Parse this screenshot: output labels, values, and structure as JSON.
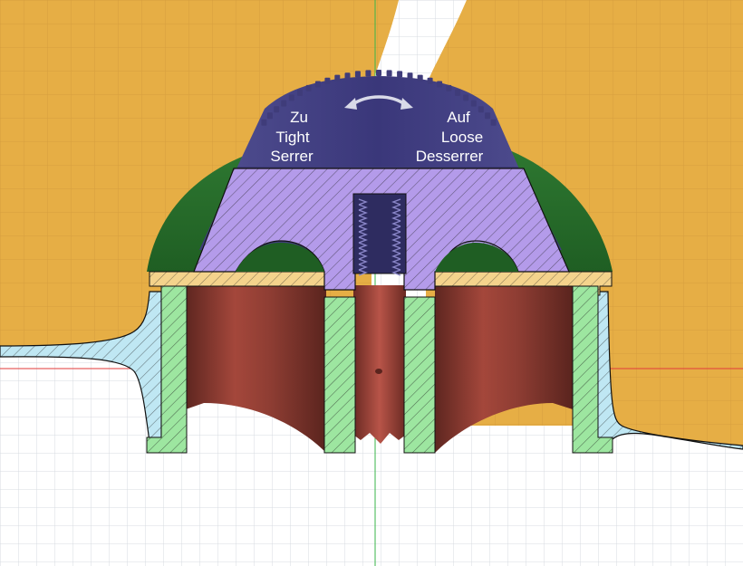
{
  "viewport": {
    "title": "",
    "cap_labels": {
      "left": [
        "Zu",
        "Tight",
        "Serrer"
      ],
      "right": [
        "Auf",
        "Loose",
        "Desserrer"
      ]
    },
    "rotation_icon": "double-arrow-icon"
  },
  "colors": {
    "ground_orange": "#E6AE45",
    "grid_white": "#FFFFFF",
    "cap_dark": "#3F3C7A",
    "cap_section": "#B49BEA",
    "green_dome": "#2E7A2F",
    "wall_blue": "#BFE7F3",
    "insert_green": "#9DE6A0",
    "yellow_ring": "#F4D38C",
    "interior_brown": "#8A3C33",
    "red_axis": "#E23A3A",
    "green_axis": "#39B54A"
  }
}
